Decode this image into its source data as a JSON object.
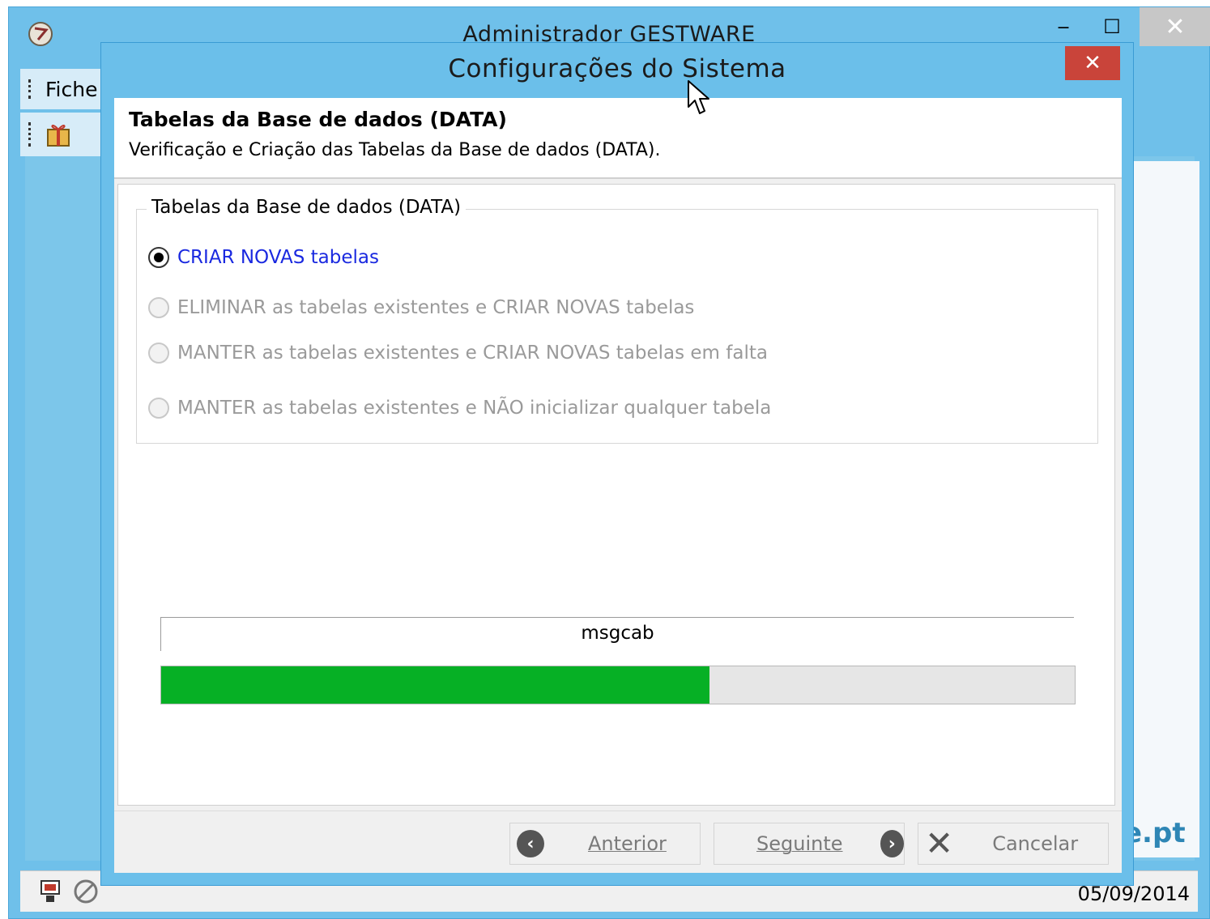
{
  "main_window": {
    "title": "Administrador GESTWARE",
    "minimize_glyph": "‒",
    "maximize_glyph": "☐",
    "close_glyph": "✕",
    "menu_file": "Fiche",
    "brand_fragment": "e.pt",
    "status_date": "05/09/2014"
  },
  "dialog": {
    "title": "Configurações do Sistema",
    "close_glyph": "✕",
    "header_title": "Tabelas da Base de dados (DATA)",
    "header_subtitle": "Verificação e Criação das Tabelas da Base de dados (DATA).",
    "group_label": "Tabelas da Base de dados (DATA)",
    "options": [
      {
        "label": "CRIAR NOVAS tabelas",
        "checked": true,
        "enabled": true
      },
      {
        "label": "ELIMINAR as tabelas existentes e CRIAR NOVAS tabelas",
        "checked": false,
        "enabled": false
      },
      {
        "label": "MANTER as tabelas existentes e CRIAR NOVAS tabelas em falta",
        "checked": false,
        "enabled": false
      },
      {
        "label": "MANTER as tabelas existentes e NÃO inicializar qualquer tabela",
        "checked": false,
        "enabled": false
      }
    ],
    "progress": {
      "label": "msgcab",
      "fraction": 0.6,
      "color": "#06b025"
    },
    "buttons": {
      "back": "Anterior",
      "next": "Seguinte",
      "cancel": "Cancelar"
    }
  },
  "icons": {
    "app": "app-icon",
    "back": "arrow-left-circle-icon",
    "next": "arrow-right-circle-icon",
    "cancel": "x-icon",
    "cursor": "mouse-cursor-icon"
  }
}
